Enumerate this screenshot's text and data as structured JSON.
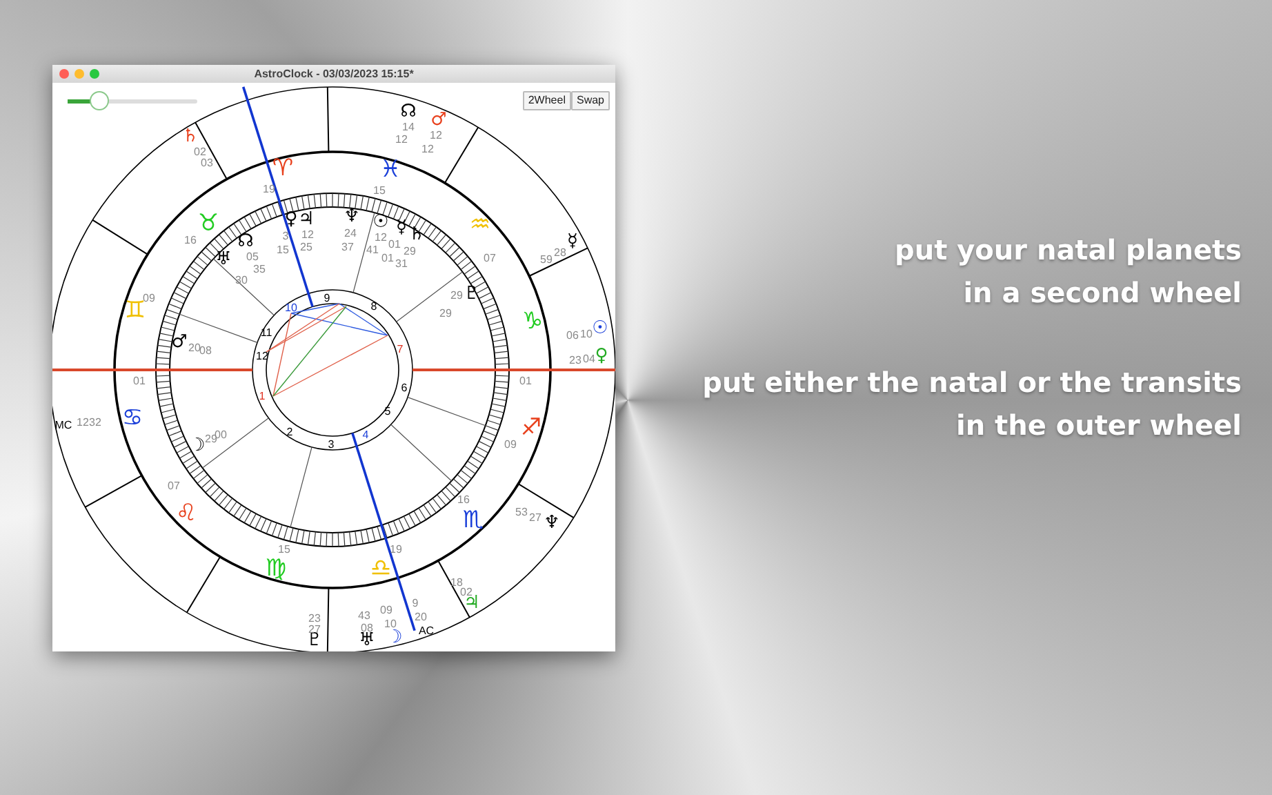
{
  "window": {
    "title": "AstroClock - 03/03/2023 15:15*"
  },
  "toolbar": {
    "zoom_slider": {
      "level": 0.24
    },
    "buttons": [
      {
        "label": "2Wheel"
      },
      {
        "label": "Swap"
      }
    ]
  },
  "chart": {
    "signs": [
      {
        "glyph": "♈",
        "color": "#e8401c"
      },
      {
        "glyph": "♉",
        "color": "#22cc22"
      },
      {
        "glyph": "♊",
        "color": "#f0c000"
      },
      {
        "glyph": "♋",
        "color": "#1a3fd9"
      },
      {
        "glyph": "♌",
        "color": "#e8401c"
      },
      {
        "glyph": "♍",
        "color": "#22cc22"
      },
      {
        "glyph": "♎",
        "color": "#f0c000"
      },
      {
        "glyph": "♏",
        "color": "#1a3fd9"
      },
      {
        "glyph": "♐",
        "color": "#e8401c"
      },
      {
        "glyph": "♑",
        "color": "#22cc22"
      },
      {
        "glyph": "♒",
        "color": "#f0c000"
      },
      {
        "glyph": "♓",
        "color": "#1a3fd9"
      }
    ],
    "cusp_degrees": [
      "19",
      "16",
      "09",
      "01",
      "07",
      "15",
      "19",
      "16",
      "09",
      "01",
      "07",
      "15"
    ],
    "house_numbers": [
      {
        "text": "1",
        "color": "#e03020"
      },
      {
        "text": "2",
        "color": "#000000"
      },
      {
        "text": "3",
        "color": "#000000"
      },
      {
        "text": "4",
        "color": "#1a3fd9"
      },
      {
        "text": "5",
        "color": "#000000"
      },
      {
        "text": "6",
        "color": "#000000"
      },
      {
        "text": "7",
        "color": "#e03020"
      },
      {
        "text": "8",
        "color": "#000000"
      },
      {
        "text": "9",
        "color": "#000000"
      },
      {
        "text": "10",
        "color": "#1a3fd9"
      },
      {
        "text": "11",
        "color": "#000000"
      },
      {
        "text": "12",
        "color": "#000000"
      }
    ],
    "natal_planets": [
      {
        "glyph": "♀",
        "color": "#000000",
        "degrees": [
          "3",
          "15"
        ]
      },
      {
        "glyph": "♃",
        "color": "#000000",
        "degrees": [
          "12",
          "25"
        ]
      },
      {
        "glyph": "♆",
        "color": "#000000",
        "degrees": [
          "24",
          "37"
        ]
      },
      {
        "glyph": "☉",
        "color": "#000000",
        "degrees": [
          "12",
          "41"
        ]
      },
      {
        "glyph": "☿",
        "color": "#000000",
        "degrees": [
          "01",
          "01"
        ]
      },
      {
        "glyph": "♄",
        "color": "#000000",
        "degrees": [
          "29",
          "31"
        ]
      },
      {
        "glyph": "☊",
        "color": "#000000",
        "degrees": [
          "05",
          "35"
        ]
      },
      {
        "glyph": "♅",
        "color": "#000000",
        "degrees": [
          "30"
        ]
      },
      {
        "glyph": "♇",
        "color": "#000000",
        "degrees": [
          "29",
          "29"
        ]
      },
      {
        "glyph": "♂",
        "color": "#000000",
        "degrees": [
          "20",
          "08"
        ]
      },
      {
        "glyph": "☽",
        "color": "#000000",
        "degrees": [
          "29",
          "00"
        ]
      }
    ],
    "transit_planets": [
      {
        "glyph": "♄",
        "color": "#e8401c",
        "degrees": [
          "02",
          "03"
        ]
      },
      {
        "glyph": "☊",
        "color": "#000000",
        "degrees": [
          "14",
          "12"
        ]
      },
      {
        "glyph": "♂",
        "color": "#e8401c",
        "degrees": [
          "12",
          "12"
        ]
      },
      {
        "glyph": "☿",
        "color": "#000000",
        "degrees": [
          "28",
          "59"
        ]
      },
      {
        "glyph": "☉",
        "color": "#1a3fd9",
        "degrees": [
          "06",
          "10"
        ]
      },
      {
        "glyph": "♀",
        "color": "#22aa22",
        "degrees": [
          "23",
          "04"
        ]
      },
      {
        "glyph": "♆",
        "color": "#000000",
        "degrees": [
          "27",
          "53"
        ]
      },
      {
        "glyph": "♃",
        "color": "#22aa22",
        "degrees": [
          "02",
          "18"
        ]
      },
      {
        "glyph": "♇",
        "color": "#000000",
        "degrees": [
          "23",
          "27"
        ]
      },
      {
        "glyph": "♅",
        "color": "#000000",
        "degrees": [
          "43",
          "08"
        ]
      },
      {
        "glyph": "☽",
        "color": "#1a3fd9",
        "degrees": [
          "09",
          "10"
        ]
      },
      {
        "glyph": "AC",
        "color": "#000000",
        "degrees": [
          "9",
          "20"
        ]
      },
      {
        "glyph": "MC",
        "color": "#000000",
        "degrees": [
          "12",
          "32"
        ]
      }
    ]
  },
  "captions": [
    {
      "lines": [
        "put your natal planets",
        "in a second wheel"
      ]
    },
    {
      "lines": [
        "put either the natal or the transits",
        "in the outer wheel"
      ]
    }
  ]
}
